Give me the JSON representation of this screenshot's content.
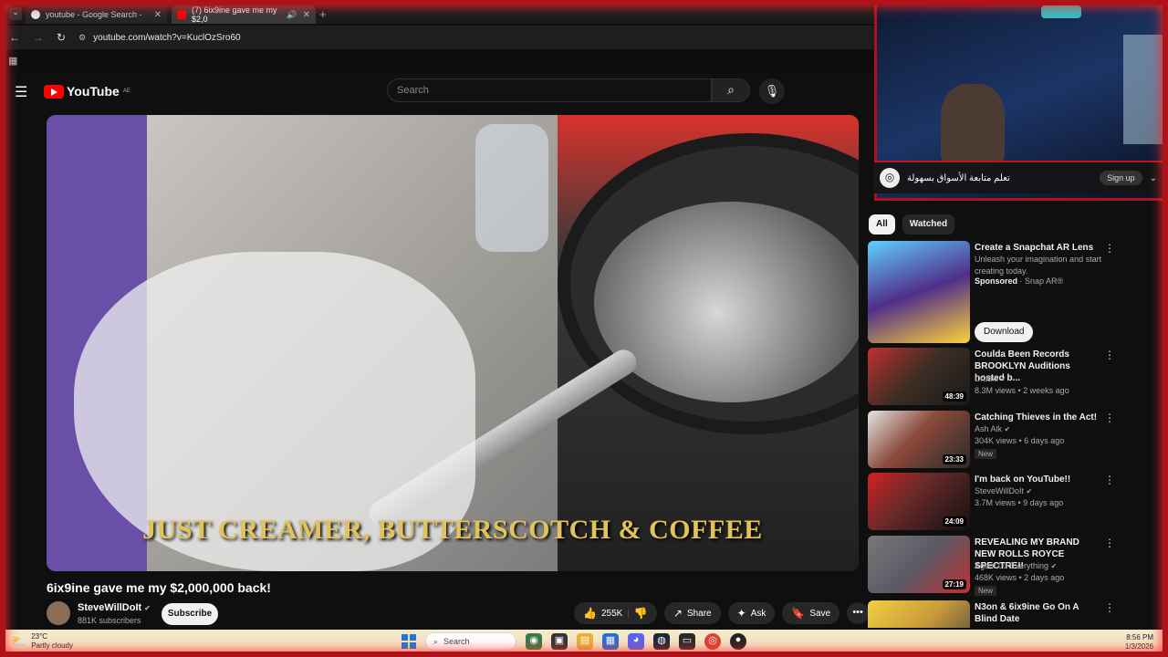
{
  "browser": {
    "tabs": [
      {
        "title": "youtube - Google Search -",
        "close": "✕"
      },
      {
        "title": "(7) 6ix9ine gave me my $2,0",
        "close": "✕"
      }
    ],
    "new_tab": "+",
    "url": "youtube.com/watch?v=KuclOzSro60"
  },
  "youtube": {
    "logo_text": "YouTube",
    "region": "AE",
    "search_placeholder": "Search"
  },
  "video": {
    "caption": "JUST CREAMER, BUTTERSCOTCH & COFFEE",
    "title": "6ix9ine gave me my $2,000,000 back!",
    "channel": "SteveWillDoIt",
    "subscribers": "881K subscribers",
    "subscribe_label": "Subscribe",
    "likes": "255K",
    "share_label": "Share",
    "ask_label": "Ask",
    "save_label": "Save"
  },
  "overlay": {
    "banner_text": "تعلم متابعة الأسواق بسهولة",
    "banner_button": "Sign up"
  },
  "sidebar": {
    "chips": [
      "All",
      "Watched"
    ],
    "items": [
      {
        "title": "Create a Snapchat AR Lens",
        "line2": "Unleash your imagination and start creating today.",
        "sponsored": "Sponsored",
        "advertiser": "Snap AR®",
        "button": "Download",
        "thumb_color": "#4f2f8a"
      },
      {
        "title": "Coulda Been Records BROOKLYN Auditions hosted b...",
        "channel": "Druski",
        "meta": "8.3M views • 2 weeks ago",
        "duration": "48:39",
        "thumb_color": "#3a2d24"
      },
      {
        "title": "Catching Thieves in the Act!",
        "channel": "Ash Alk",
        "meta": "304K views • 6 days ago",
        "badge": "New",
        "duration": "23:33",
        "thumb_color": "#8a4a3a"
      },
      {
        "title": "I'm back on YouTube!!",
        "channel": "SteveWillDoIt",
        "meta": "3.7M views • 9 days ago",
        "duration": "24:09",
        "thumb_color": "#6b2a2a"
      },
      {
        "title": "REVEALING MY BRAND NEW ROLLS ROYCE SPECTRE!!",
        "channel": "Agent 00 Everything",
        "meta": "468K views • 2 days ago",
        "badge": "New",
        "duration": "27:19",
        "thumb_color": "#5a5a66"
      },
      {
        "title": "N3on & 6ix9ine Go On A Blind Date",
        "thumb_color": "#c89a3a"
      }
    ]
  },
  "taskbar": {
    "temp": "23°C",
    "condition": "Partly cloudy",
    "search": "Search",
    "time": "8:56 PM",
    "date": "1/3/2026"
  }
}
